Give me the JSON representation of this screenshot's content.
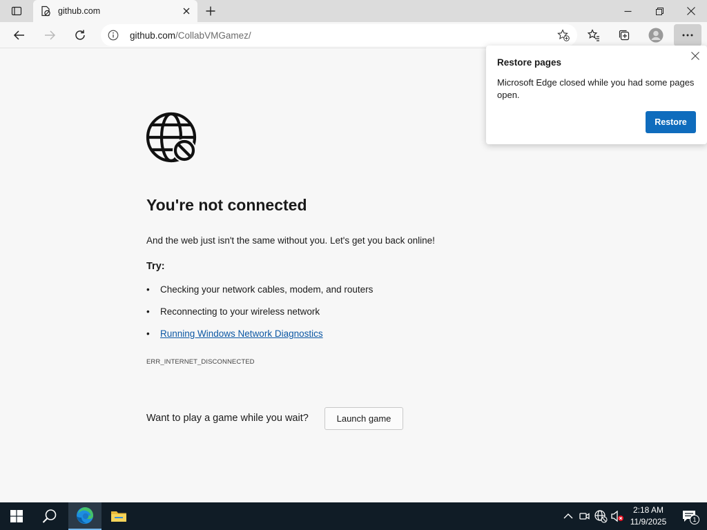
{
  "browser": {
    "tab_title": "github.com",
    "address_host": "github.com",
    "address_path": "/CollabVMGamez/"
  },
  "error_page": {
    "title": "You're not connected",
    "description": "And the web just isn't the same without you. Let's get you back online!",
    "try_label": "Try:",
    "suggestions": [
      "Checking your network cables, modem, and routers",
      "Reconnecting to your wireless network",
      "Running Windows Network Diagnostics"
    ],
    "error_code": "ERR_INTERNET_DISCONNECTED",
    "game_prompt": "Want to play a game while you wait?",
    "game_button": "Launch game"
  },
  "restore_popup": {
    "title": "Restore pages",
    "message": "Microsoft Edge closed while you had some pages open.",
    "button": "Restore"
  },
  "taskbar": {
    "time": "2:18 AM",
    "date": "11/9/2025",
    "notification_count": "1"
  },
  "colors": {
    "accent": "#0f6cbd",
    "link": "#0b57a4",
    "taskbar": "#101c26"
  }
}
